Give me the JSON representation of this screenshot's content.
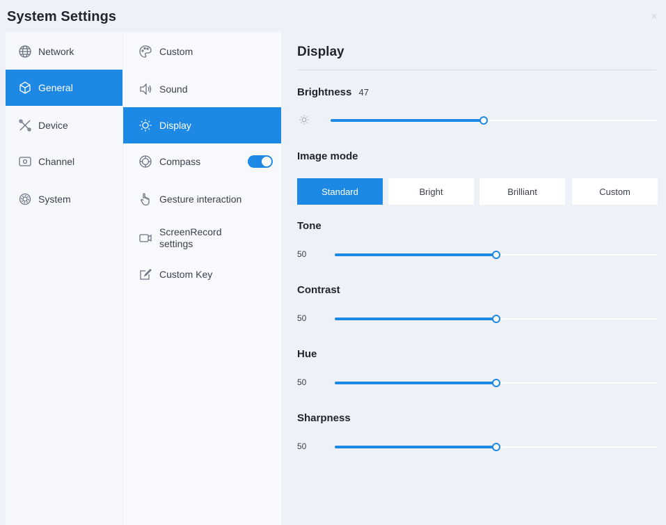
{
  "window": {
    "title": "System Settings",
    "close_glyph": "×"
  },
  "colors": {
    "accent": "#1e88e5",
    "background": "#eef1f8"
  },
  "nav": {
    "items": [
      {
        "label": "Network",
        "icon": "globe-icon"
      },
      {
        "label": "General",
        "icon": "cube-icon",
        "active": true
      },
      {
        "label": "Device",
        "icon": "tools-icon"
      },
      {
        "label": "Channel",
        "icon": "input-icon"
      },
      {
        "label": "System",
        "icon": "gear-icon"
      }
    ]
  },
  "subnav": {
    "items": [
      {
        "label": "Custom",
        "icon": "palette-icon"
      },
      {
        "label": "Sound",
        "icon": "speaker-icon"
      },
      {
        "label": "Display",
        "icon": "sun-icon",
        "active": true
      },
      {
        "label": "Compass",
        "icon": "compass-icon",
        "toggle_on": true
      },
      {
        "label": "Gesture interaction",
        "icon": "hand-icon"
      },
      {
        "label": "ScreenRecord\nsettings",
        "label_line1": "ScreenRecord",
        "label_line2": "settings",
        "icon": "camera-icon"
      },
      {
        "label": "Custom Key",
        "icon": "edit-icon"
      }
    ]
  },
  "panel": {
    "title": "Display",
    "brightness": {
      "label": "Brightness",
      "value": "47",
      "level": 47
    },
    "image_mode": {
      "label": "Image mode",
      "options": [
        "Standard",
        "Bright",
        "Brilliant",
        "Custom"
      ],
      "selected": "Standard"
    },
    "tone": {
      "label": "Tone",
      "value": "50",
      "level": 50
    },
    "contrast": {
      "label": "Contrast",
      "value": "50",
      "level": 50
    },
    "hue": {
      "label": "Hue",
      "value": "50",
      "level": 50
    },
    "sharpness": {
      "label": "Sharpness",
      "value": "50",
      "level": 50
    }
  }
}
